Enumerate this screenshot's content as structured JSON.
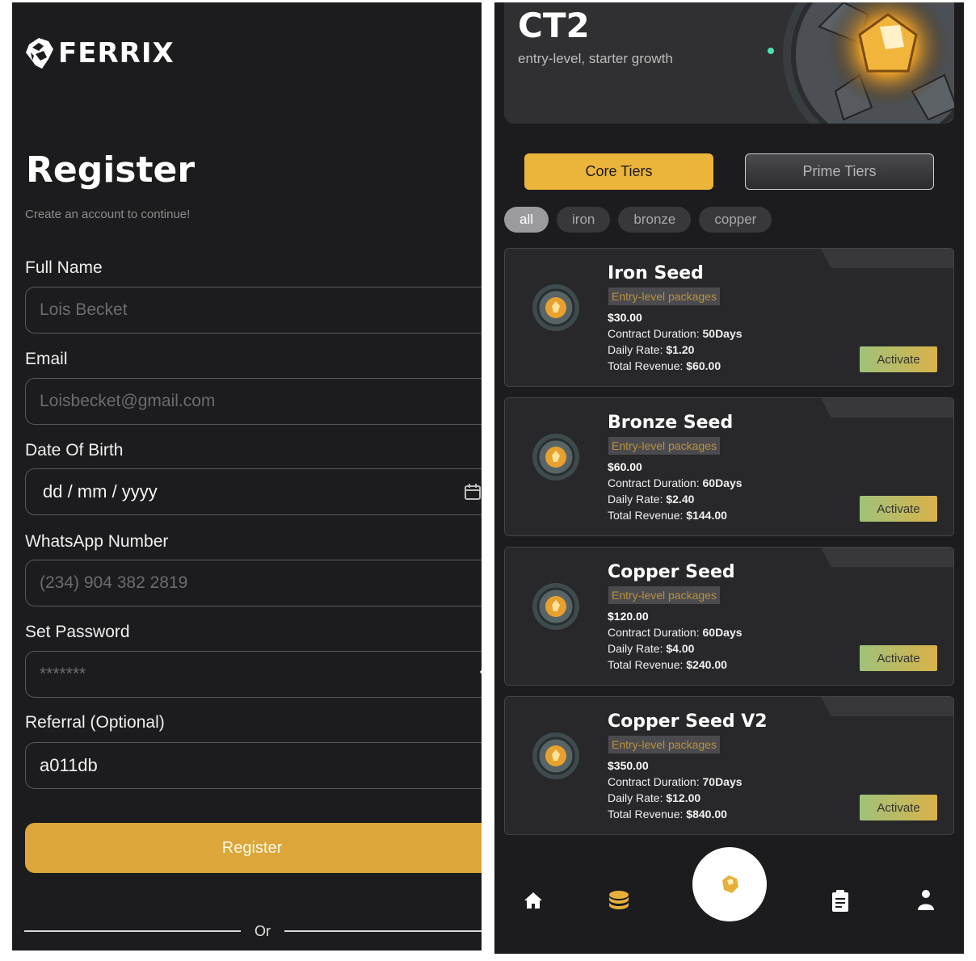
{
  "register_screen": {
    "brand": "FERRIX",
    "title": "Register",
    "subtitle": "Create an account to continue!",
    "fields": {
      "full_name": {
        "label": "Full Name",
        "placeholder": "Lois Becket"
      },
      "email": {
        "label": "Email",
        "placeholder": "Loisbecket@gmail.com"
      },
      "dob": {
        "label": "Date Of Birth",
        "value": "dd / mm / yyyy"
      },
      "whatsapp": {
        "label": "WhatsApp Number",
        "placeholder": "(234) 904 382 2819"
      },
      "password": {
        "label": "Set Password",
        "placeholder": "*******"
      },
      "referral": {
        "label": "Referral (Optional)",
        "value": "a011db"
      }
    },
    "register_button": "Register",
    "or_text": "Or"
  },
  "packages_screen": {
    "hero": {
      "title": "CT2",
      "subtitle": "entry-level, starter growth"
    },
    "tier_tabs": {
      "core": "Core Tiers",
      "prime": "Prime Tiers",
      "active": "core"
    },
    "filters": [
      "all",
      "iron",
      "bronze",
      "copper"
    ],
    "active_filter": "all",
    "labels": {
      "duration": "Contract Duration:",
      "daily": "Daily Rate:",
      "total": "Total Revenue:"
    },
    "packages": [
      {
        "name": "Iron Seed",
        "tag": "Entry-level packages",
        "price": "$30.00",
        "duration": "50Days",
        "daily_rate": "$1.20",
        "total_revenue": "$60.00",
        "action": "Activate"
      },
      {
        "name": "Bronze Seed",
        "tag": "Entry-level packages",
        "price": "$60.00",
        "duration": "60Days",
        "daily_rate": "$2.40",
        "total_revenue": "$144.00",
        "action": "Activate"
      },
      {
        "name": "Copper Seed",
        "tag": "Entry-level packages",
        "price": "$120.00",
        "duration": "60Days",
        "daily_rate": "$4.00",
        "total_revenue": "$240.00",
        "action": "Activate"
      },
      {
        "name": "Copper Seed V2",
        "tag": "Entry-level packages",
        "price": "$350.00",
        "duration": "70Days",
        "daily_rate": "$12.00",
        "total_revenue": "$840.00",
        "action": "Activate"
      }
    ],
    "bottom_nav": [
      "home-icon",
      "coins-icon",
      "ore-icon",
      "clipboard-icon",
      "profile-icon"
    ],
    "colors": {
      "accent": "#dca63a",
      "background": "#1c1c1e",
      "card": "#28282b"
    }
  }
}
